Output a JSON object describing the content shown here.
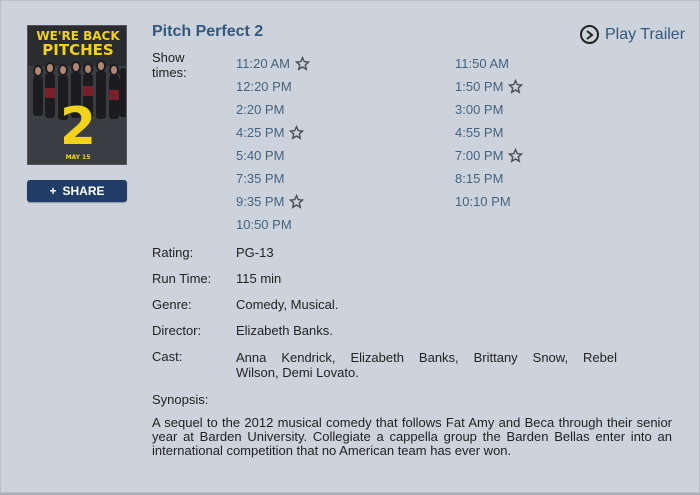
{
  "movie": {
    "title": "Pitch Perfect 2",
    "poster": {
      "tagline_top": "WE'RE BACK",
      "tagline_bottom": "PITCHES",
      "number": "2",
      "date": "MAY 15"
    }
  },
  "share_label": "SHARE",
  "share_plus": "+",
  "play_trailer_label": "Play Trailer",
  "showtimes_label": "Show times:",
  "showtimes_left": [
    {
      "time": "11:20 AM",
      "star": true
    },
    {
      "time": "12:20 PM",
      "star": false
    },
    {
      "time": "2:20 PM",
      "star": false
    },
    {
      "time": "4:25 PM",
      "star": true
    },
    {
      "time": "5:40 PM",
      "star": false
    },
    {
      "time": "7:35 PM",
      "star": false
    },
    {
      "time": "9:35 PM",
      "star": true
    },
    {
      "time": "10:50 PM",
      "star": false
    }
  ],
  "showtimes_right": [
    {
      "time": "11:50 AM",
      "star": false
    },
    {
      "time": "1:50 PM",
      "star": true
    },
    {
      "time": "3:00 PM",
      "star": false
    },
    {
      "time": "4:55 PM",
      "star": false
    },
    {
      "time": "7:00 PM",
      "star": true
    },
    {
      "time": "8:15 PM",
      "star": false
    },
    {
      "time": "10:10 PM",
      "star": false
    }
  ],
  "details": {
    "rating_label": "Rating:",
    "rating": "PG-13",
    "runtime_label": "Run Time:",
    "runtime": "115 min",
    "genre_label": "Genre:",
    "genre": "Comedy, Musical.",
    "director_label": "Director:",
    "director": "Elizabeth Banks.",
    "cast_label": "Cast:",
    "cast_line1": "Anna Kendrick, Elizabeth Banks, Brittany Snow, Rebel",
    "cast_line2": "Wilson, Demi Lovato.",
    "synopsis_label": "Synopsis:",
    "synopsis": "A sequel to the 2012 musical comedy that follows Fat Amy and Beca through their senior year at Barden University. Collegiate a cappella group the Barden Bellas enter into an international competition that no American team has ever won."
  },
  "colors": {
    "panel_bg": "#ccd3dc",
    "title": "#35577c",
    "time": "#46627f",
    "share_bg": "#1f3d66",
    "poster_yellow": "#f2d21b"
  },
  "icons": {
    "star": "star-badge-icon",
    "play": "play-circle-icon"
  }
}
